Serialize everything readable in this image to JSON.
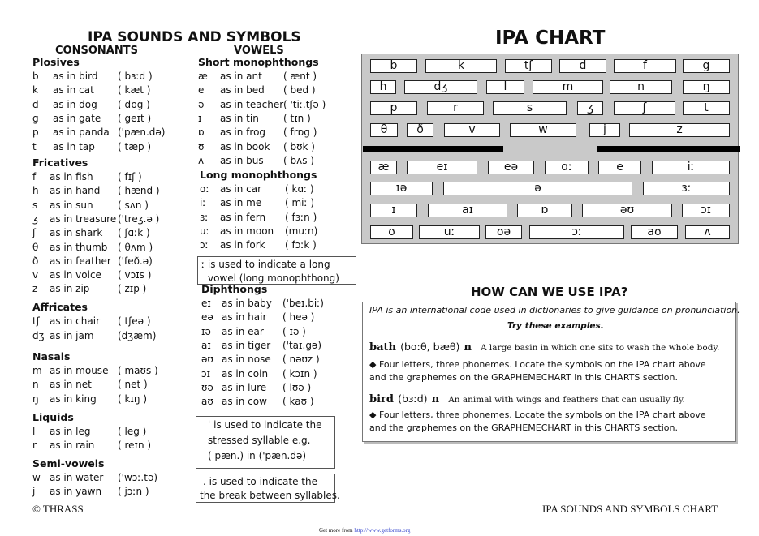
{
  "header": {
    "main_title": "IPA SOUNDS AND SYMBOLS",
    "consonants_title": "CONSONANTS",
    "vowels_title": "VOWELS",
    "chart_title": "IPA CHART"
  },
  "consonants": {
    "plosives": {
      "title": "Plosives",
      "rows": [
        {
          "sym": "b",
          "word": "as in bird",
          "ipa": "( bɜːd )"
        },
        {
          "sym": "k",
          "word": "as in cat",
          "ipa": "( kæt )"
        },
        {
          "sym": "d",
          "word": "as in dog",
          "ipa": "( dɒg )"
        },
        {
          "sym": "g",
          "word": "as in gate",
          "ipa": "( geɪt )"
        },
        {
          "sym": "p",
          "word": "as in panda",
          "ipa": "('pæn.də)"
        },
        {
          "sym": "t",
          "word": "as in tap",
          "ipa": "( tæp )"
        }
      ]
    },
    "fricatives": {
      "title": "Fricatives",
      "rows": [
        {
          "sym": "f",
          "word": "as in fish",
          "ipa": "( fɪʃ )"
        },
        {
          "sym": "h",
          "word": "as in hand",
          "ipa": "( hænd )"
        },
        {
          "sym": "s",
          "word": "as in sun",
          "ipa": "( sʌn )"
        },
        {
          "sym": "ʒ",
          "word": "as in treasure",
          "ipa": "('treʒ.ə )"
        },
        {
          "sym": "ʃ",
          "word": "as in shark",
          "ipa": "( ʃɑːk )"
        },
        {
          "sym": "θ",
          "word": "as in thumb",
          "ipa": "( θʌm )"
        },
        {
          "sym": "ð",
          "word": "as in feather",
          "ipa": "('feð.ə)"
        },
        {
          "sym": "v",
          "word": "as in voice",
          "ipa": "( vɔɪs )"
        },
        {
          "sym": "z",
          "word": "as in zip",
          "ipa": "( zɪp )"
        }
      ]
    },
    "affricates": {
      "title": "Affricates",
      "rows": [
        {
          "sym": "tʃ",
          "word": "as in chair",
          "ipa": "( tʃeə )"
        },
        {
          "sym": "dʒ",
          "word": "as in jam",
          "ipa": "(dʒæm)"
        }
      ]
    },
    "nasals": {
      "title": "Nasals",
      "rows": [
        {
          "sym": "m",
          "word": "as in mouse",
          "ipa": "( maʊs )"
        },
        {
          "sym": "n",
          "word": "as in net",
          "ipa": "( net )"
        },
        {
          "sym": "ŋ",
          "word": "as in king",
          "ipa": "( kɪŋ )"
        }
      ]
    },
    "liquids": {
      "title": "Liquids",
      "rows": [
        {
          "sym": "l",
          "word": "as in leg",
          "ipa": "( leg )"
        },
        {
          "sym": "r",
          "word": "as in rain",
          "ipa": "( reɪn )"
        }
      ]
    },
    "semivowels": {
      "title": "Semi-vowels",
      "rows": [
        {
          "sym": "w",
          "word": "as in water",
          "ipa": "('wɔː.tə)"
        },
        {
          "sym": "j",
          "word": "as in yawn",
          "ipa": "( jɔːn )"
        }
      ]
    }
  },
  "vowels": {
    "short": {
      "title": "Short monophthongs",
      "rows": [
        {
          "sym": "æ",
          "word": "as in ant",
          "ipa": "( ænt )"
        },
        {
          "sym": "e",
          "word": "as in bed",
          "ipa": "( bed )"
        },
        {
          "sym": "ə",
          "word": "as in teacher",
          "ipa": "( 'tiː.tʃə )"
        },
        {
          "sym": "ɪ",
          "word": "as in tin",
          "ipa": "( tɪn )"
        },
        {
          "sym": "ɒ",
          "word": "as in frog",
          "ipa": "( frɒg )"
        },
        {
          "sym": "ʊ",
          "word": "as in book",
          "ipa": "( bʊk )"
        },
        {
          "sym": "ʌ",
          "word": "as in bus",
          "ipa": "( bʌs )"
        }
      ]
    },
    "long": {
      "title": "Long monophthongs",
      "rows": [
        {
          "sym": "ɑː",
          "word": "as in car",
          "ipa": "( kɑː )"
        },
        {
          "sym": "iː",
          "word": "as in me",
          "ipa": "( miː )"
        },
        {
          "sym": "ɜː",
          "word": "as in fern",
          "ipa": "( fɜːn )"
        },
        {
          "sym": "uː",
          "word": "as in moon",
          "ipa": "(muːn)"
        },
        {
          "sym": "ɔː",
          "word": "as in fork",
          "ipa": "( fɔːk )"
        }
      ],
      "note_line1": "ː is used to indicate a long",
      "note_line2": "vowel (long monophthong)"
    },
    "diphthongs": {
      "title": "Diphthongs",
      "rows": [
        {
          "sym": "eɪ",
          "word": "as in baby",
          "ipa": "('beɪ.biː)"
        },
        {
          "sym": "eə",
          "word": "as in hair",
          "ipa": "( heə )"
        },
        {
          "sym": "ɪə",
          "word": "as in ear",
          "ipa": "( ɪə )"
        },
        {
          "sym": "aɪ",
          "word": "as in tiger",
          "ipa": "('taɪ.gə)"
        },
        {
          "sym": "əʊ",
          "word": "as in nose",
          "ipa": "( nəʊz )"
        },
        {
          "sym": "ɔɪ",
          "word": "as in coin",
          "ipa": "( kɔɪn )"
        },
        {
          "sym": "ʊə",
          "word": "as in lure",
          "ipa": "( lʊə )"
        },
        {
          "sym": "aʊ",
          "word": "as in cow",
          "ipa": "( kaʊ )"
        }
      ]
    },
    "stress_note": {
      "line1": "ˈ is used to indicate the",
      "line2": "stressed syllable e.g.",
      "line3": "( pæn.)   in   ('pæn.də)"
    },
    "break_note": {
      "line1": ". is used to indicate the",
      "line2": "the break between syllables."
    }
  },
  "ipa_chart": {
    "background": "#c9c9c9",
    "consonant_rows": [
      [
        "b",
        "k",
        "tʃ",
        "d",
        "f",
        "g"
      ],
      [
        "h",
        "dʒ",
        "l",
        "m",
        "n",
        "ŋ"
      ],
      [
        "p",
        "r",
        "s",
        "ʒ",
        "ʃ",
        "t"
      ],
      [
        "θ",
        "ð",
        "v",
        "w",
        "j",
        "z"
      ]
    ],
    "vowel_rows": [
      [
        "æ",
        "eɪ",
        "eə",
        "ɑː",
        "e",
        "iː"
      ],
      [
        "ɪə",
        "ə",
        "ɜː"
      ],
      [
        "ɪ",
        "aɪ",
        "ɒ",
        "əʊ",
        "ɔɪ"
      ],
      [
        "ʊ",
        "uː",
        "ʊə",
        "ɔː",
        "aʊ",
        "ʌ"
      ]
    ]
  },
  "how": {
    "title": "HOW CAN WE USE IPA?",
    "intro": "IPA is an international code used in dictionaries to give guidance on pronunciation.",
    "try": "Try these examples.",
    "ex1_word": "bath",
    "ex1_ipa": "(bɑːθ, bæθ)",
    "ex1_pos": "n",
    "ex1_def": "A large basin in which one sits to wash the whole body.",
    "ex1_task_line1": "◆  Four letters, three phonemes. Locate the symbols on the IPA chart above",
    "ex1_task_line2": "and the graphemes on the GRAPHEMECHART in this CHARTS section.",
    "ex2_word": "bird",
    "ex2_ipa": "(bɜːd)",
    "ex2_pos": "n",
    "ex2_def": "An animal with wings and feathers that can usually fly.",
    "ex2_task_line1": "◆  Four letters, three phonemes. Locate the symbols on the IPA chart above",
    "ex2_task_line2": "and the graphemes on the GRAPHEMECHART in this CHARTS section."
  },
  "footer": {
    "copyright": "© THRASS",
    "doc_title": "IPA SOUNDS AND SYMBOLS CHART",
    "getmore_prefix": "Get more from ",
    "getmore_link": "http://www.getforms.org"
  }
}
